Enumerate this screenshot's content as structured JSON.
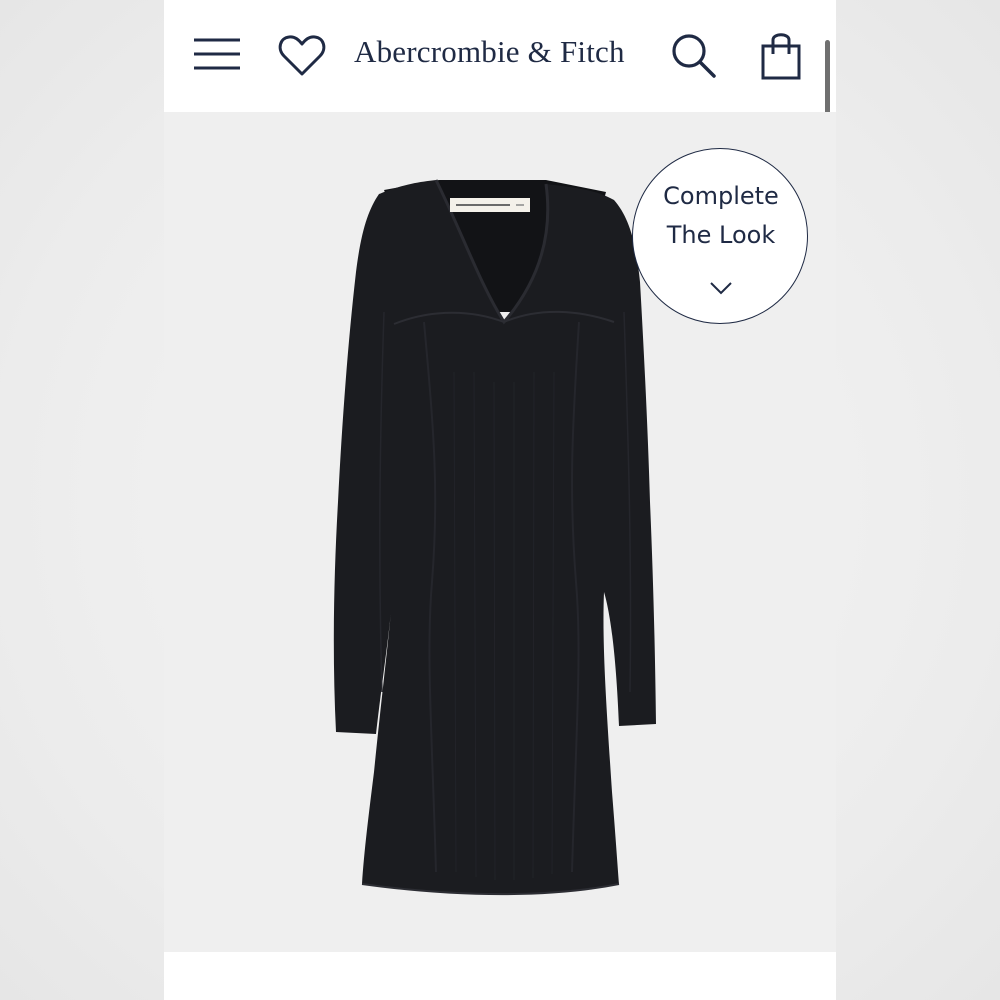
{
  "header": {
    "brand": "Abercrombie & Fitch",
    "icons": [
      "menu-icon",
      "heart-icon",
      "search-icon",
      "shopping-bag-icon"
    ]
  },
  "product": {
    "image": "black ribbed long-sleeve sweetheart neckline mini sweater dress",
    "dress_color": "#1b1c20"
  },
  "complete_the_look": {
    "line1": "Complete",
    "line2": "The Look",
    "icon": "chevron-down-icon"
  },
  "colors": {
    "brand_navy": "#1f2a44",
    "background": "#efefef"
  }
}
